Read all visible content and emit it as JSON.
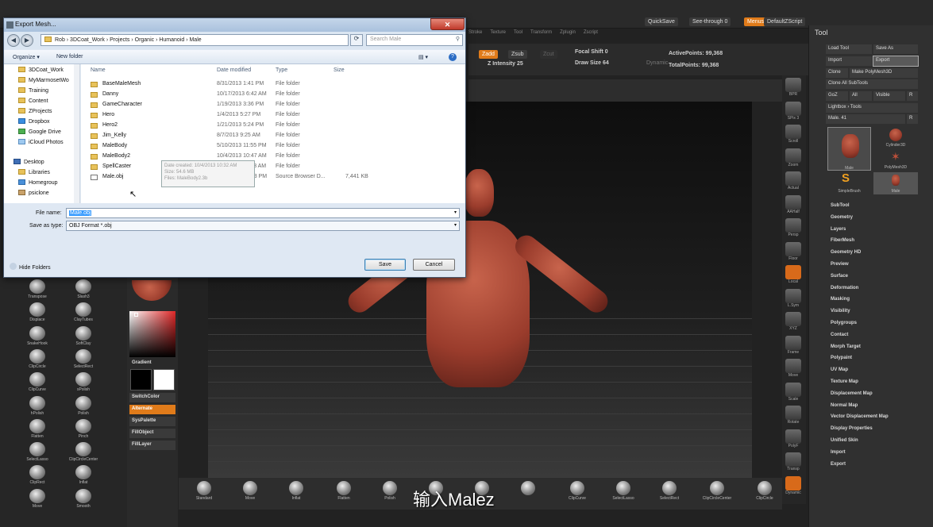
{
  "dialog": {
    "title": "Export Mesh...",
    "close": "✕",
    "address": "Rob  ›  3DCoat_Work  ›  Projects  ›  Organic  ›  Humanoid  ›  Male",
    "search_placeholder": "Search Male",
    "toolbar": {
      "organize": "Organize ▾",
      "new_folder": "New folder"
    },
    "nav_items": [
      "3DCoat_Work",
      "MyMarmosetWo",
      "Training",
      "Content",
      "ZProjects",
      "Dropbox",
      "Google Drive",
      "iCloud Photos",
      "Desktop",
      "Libraries",
      "Homegroup",
      "psiclone"
    ],
    "columns": {
      "name": "Name",
      "date": "Date modified",
      "type": "Type",
      "size": "Size"
    },
    "files": [
      {
        "name": "BaseMaleMesh",
        "date": "8/31/2013 1:41 PM",
        "type": "File folder",
        "size": ""
      },
      {
        "name": "Danny",
        "date": "10/17/2013 6:42 AM",
        "type": "File folder",
        "size": ""
      },
      {
        "name": "GameCharacter",
        "date": "1/19/2013 3:36 PM",
        "type": "File folder",
        "size": ""
      },
      {
        "name": "Hero",
        "date": "1/4/2013 5:27 PM",
        "type": "File folder",
        "size": ""
      },
      {
        "name": "Hero2",
        "date": "1/21/2013 5:24 PM",
        "type": "File folder",
        "size": ""
      },
      {
        "name": "Jim_Kelly",
        "date": "8/7/2013 9:25 AM",
        "type": "File folder",
        "size": ""
      },
      {
        "name": "MaleBody",
        "date": "5/10/2013 11:55 PM",
        "type": "File folder",
        "size": ""
      },
      {
        "name": "MaleBody2",
        "date": "10/4/2013 10:47 AM",
        "type": "File folder",
        "size": ""
      },
      {
        "name": "SpellCaster",
        "date": "10/4/2013 11:13 AM",
        "type": "File folder",
        "size": ""
      },
      {
        "name": "Male.obj",
        "date": "10/25/2013 2:03 PM",
        "type": "Source Browser D...",
        "size": "7,441 KB"
      }
    ],
    "tooltip": [
      "Date created: 10/4/2013 10:32 AM",
      "Size: 54.6 MB",
      "Files: MaleBody2.3b"
    ],
    "file_name_label": "File name:",
    "file_name_value": "Male.obj",
    "save_as_label": "Save as type:",
    "save_as_value": "OBJ Format *.obj",
    "hide_folders": "Hide Folders",
    "save": "Save",
    "cancel": "Cancel"
  },
  "zbrush": {
    "top": {
      "quicksave": "QuickSave",
      "seethrough": "See-through  0",
      "menus": "Menus",
      "script": "DefaultZScript"
    },
    "menu_strip": [
      "Stroke",
      "Texture",
      "Tool",
      "Transform",
      "Zplugin",
      "Zscript"
    ],
    "draw": {
      "zadd": "Zadd",
      "zsub": "Zsub",
      "zcut": "Zcut",
      "intensity": "Z Intensity 25",
      "focal": "Focal Shift 0",
      "drawsize": "Draw Size 64",
      "dynamic": "Dynamic",
      "active": "ActivePoints: 99,368",
      "total": "TotalPoints: 99,368"
    },
    "tool": {
      "title": "Tool",
      "load": "Load Tool",
      "saveas": "Save As",
      "import": "Import",
      "export": "Export",
      "clone": "Clone",
      "polymesh": "Make PolyMesh3D",
      "cloneall": "Clone All SubTools",
      "goz": "GoZ",
      "all": "All",
      "visible": "Visible",
      "r": "R",
      "lightbox": "Lightbox › Tools",
      "male": "Male. 41",
      "thumbs": [
        "Male",
        "Cylinder3D",
        "PolyMesh3D",
        "SimpleBrush",
        "Male"
      ],
      "sections": [
        "SubTool",
        "Geometry",
        "Layers",
        "FiberMesh",
        "Geometry HD",
        "Preview",
        "Surface",
        "Deformation",
        "Masking",
        "Visibility",
        "Polygroups",
        "Contact",
        "Morph Target",
        "Polypaint",
        "UV Map",
        "Texture Map",
        "Displacement Map",
        "Normal Map",
        "Vector Displacement Map",
        "Display Properties",
        "Unified Skin",
        "Import",
        "Export"
      ]
    },
    "right_tools": [
      "BPR",
      "SPix 3",
      "Scroll",
      "Zoom",
      "Actual",
      "AAHalf",
      "Persp",
      "Floor",
      "Local",
      "L.Sym",
      "XYZ",
      "Frame",
      "Move",
      "Scale",
      "Rotate",
      "PolyF",
      "Transp",
      "Dynamic"
    ],
    "left_brushes": [
      "Transpose",
      "Slash3",
      "Displace",
      "ClayTubes",
      "SnakeHook",
      "SoftClay",
      "ClipCircle",
      "SelectRect",
      "ClipCurve",
      "sPolish",
      "hPolish",
      "Polish",
      "Flatten",
      "Pinch",
      "SelectLasso",
      "ClipCircleCenter",
      "ClipRect",
      "Inflat",
      "Move",
      "Smooth"
    ],
    "color": {
      "matcap": "MatCap Red Wax",
      "gradient": "Gradient",
      "switch": "SwitchColor",
      "alternate": "Alternate",
      "syspalette": "SysPalette",
      "fillobject": "FillObject",
      "filllayer": "FillLayer"
    },
    "bottom_brushes": [
      "Standard",
      "Move",
      "Inflat",
      "Flatten",
      "Polish",
      "",
      "",
      "",
      "ClipCurve",
      "SelectLasso",
      "SelectRect",
      "ClipCircleCenter",
      "ClipCircle"
    ],
    "subtitle": "输入Malez"
  }
}
